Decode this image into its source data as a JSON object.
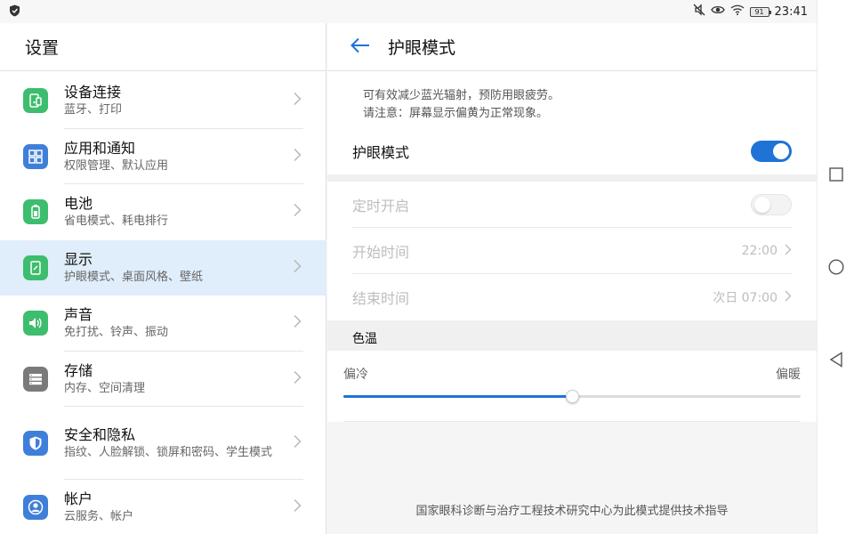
{
  "status_bar": {
    "battery": "91",
    "time": "23:41"
  },
  "left_panel": {
    "title": "设置",
    "items": [
      {
        "title": "设备连接",
        "subtitle": "蓝牙、打印",
        "icon": "device-connect-icon",
        "color": "#3dbd6e"
      },
      {
        "title": "应用和通知",
        "subtitle": "权限管理、默认应用",
        "icon": "apps-grid-icon",
        "color": "#3f7fd9"
      },
      {
        "title": "电池",
        "subtitle": "省电模式、耗电排行",
        "icon": "battery-icon",
        "color": "#3dbd6e"
      },
      {
        "title": "显示",
        "subtitle": "护眼模式、桌面风格、壁纸",
        "icon": "display-icon",
        "color": "#3dbd6e"
      },
      {
        "title": "声音",
        "subtitle": "免打扰、铃声、振动",
        "icon": "speaker-icon",
        "color": "#3dbd6e"
      },
      {
        "title": "存储",
        "subtitle": "内存、空间清理",
        "icon": "storage-icon",
        "color": "#7a7a7a"
      },
      {
        "title": "安全和隐私",
        "subtitle": "指纹、人脸解锁、锁屏和密码、学生模式",
        "icon": "shield-icon",
        "color": "#3f7fd9"
      },
      {
        "title": "帐户",
        "subtitle": "云服务、帐户",
        "icon": "account-icon",
        "color": "#3f7fd9"
      }
    ]
  },
  "right_panel": {
    "title": "护眼模式",
    "description_line1": "可有效减少蓝光辐射，预防用眼疲劳。",
    "description_line2": "请注意：屏幕显示偏黄为正常现象。",
    "eye_comfort": {
      "label": "护眼模式",
      "enabled": true
    },
    "schedule": {
      "label": "定时开启",
      "enabled": false
    },
    "start_time": {
      "label": "开始时间",
      "value": "22:00"
    },
    "end_time": {
      "label": "结束时间",
      "value": "次日 07:00"
    },
    "color_temp": {
      "section_label": "色温",
      "cold_label": "偏冷",
      "warm_label": "偏暖",
      "value": 0.5
    },
    "footer": "国家眼科诊断与治疗工程技术研究中心为此模式提供技术指导"
  },
  "colors": {
    "accent": "#1f73d6",
    "selected_bg": "#e0edfa"
  }
}
